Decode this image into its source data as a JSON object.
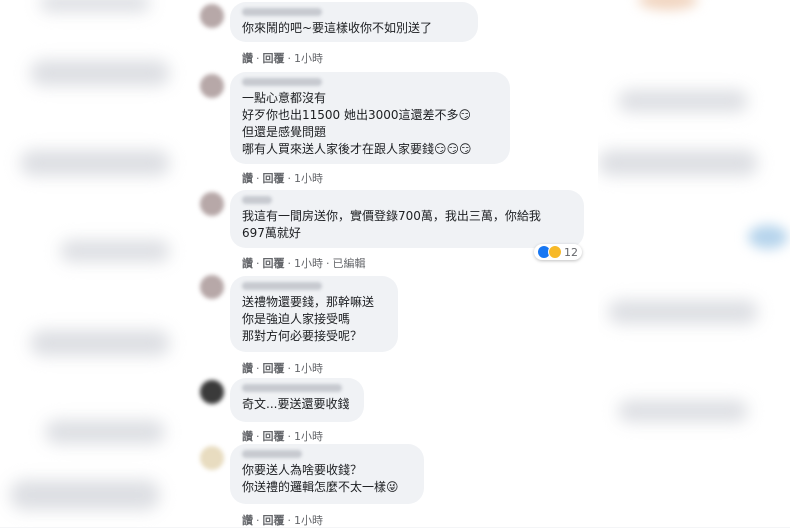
{
  "comments": [
    {
      "text": "你來鬧的吧~要這樣收你不如別送了",
      "actions": {
        "like": "讚",
        "reply": "回覆",
        "time": "1小時"
      }
    },
    {
      "text": "一點心意都沒有\n好歹你也出11500 她出3000這還差不多😏\n但還是感覺問題\n哪有人買來送人家後才在跟人家要錢😏😏😏",
      "actions": {
        "like": "讚",
        "reply": "回覆",
        "time": "1小時"
      }
    },
    {
      "text": "我這有一間房送你，實價登錄700萬，我出三萬，你給我\n697萬就好",
      "actions": {
        "like": "讚",
        "reply": "回覆",
        "time": "1小時",
        "edited": "已編輯"
      },
      "reaction_count": "12"
    },
    {
      "text": "送禮物還要錢，那幹嘛送\n你是強迫人家接受嗎\n那對方何必要接受呢？",
      "actions": {
        "like": "讚",
        "reply": "回覆",
        "time": "1小時"
      }
    },
    {
      "text": "奇文...要送還要收錢",
      "actions": {
        "like": "讚",
        "reply": "回覆",
        "time": "1小時"
      }
    },
    {
      "text": "你要送人為啥要收錢？\n你送禮的邏輯怎麼不太一樣😜",
      "actions": {
        "like": "讚",
        "reply": "回覆",
        "time": "1小時"
      }
    }
  ],
  "colors": {
    "bubble": "#f0f2f5",
    "action_text": "#65676b",
    "text": "#1c1e21"
  }
}
